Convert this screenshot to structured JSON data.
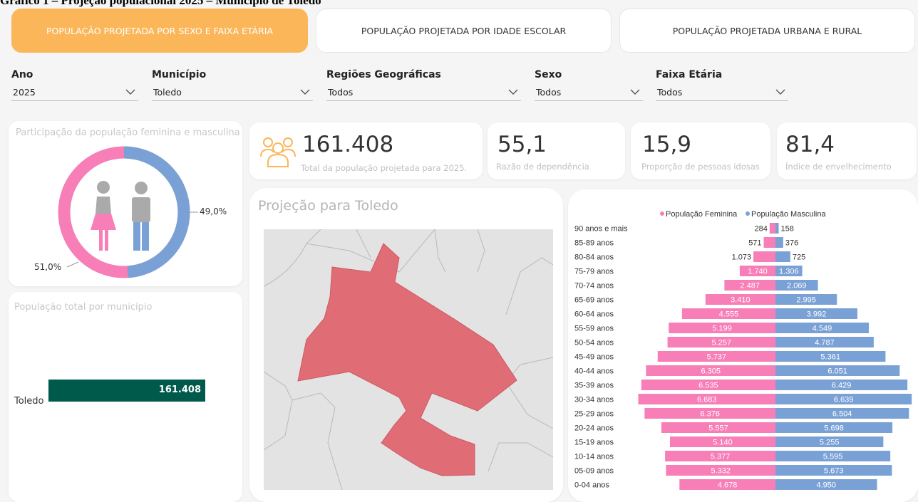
{
  "heading": "Gráfico 1 – Projeção populacional 2025 – Município de Toledo",
  "tabs": [
    {
      "label": "POPULAÇÃO PROJETADA POR SEXO E FAIXA ETÁRIA",
      "active": true
    },
    {
      "label": "POPULAÇÃO PROJETADA POR IDADE ESCOLAR",
      "active": false
    },
    {
      "label": "POPULAÇÃO PROJETADA URBANA E RURAL",
      "active": false
    }
  ],
  "filters": [
    {
      "label": "Ano",
      "value": "2025"
    },
    {
      "label": "Município",
      "value": "Toledo"
    },
    {
      "label": "Regiões Geográficas",
      "value": "Todos"
    },
    {
      "label": "Sexo",
      "value": "Todos"
    },
    {
      "label": "Faixa Etária",
      "value": "Todos"
    }
  ],
  "donut": {
    "title": "Participação da população feminina e masculina",
    "male_label": "49,0%",
    "female_label": "51,0%",
    "male_share": 0.49,
    "female_color": "#f77eb6",
    "male_color": "#7aa1d6"
  },
  "kpis": [
    {
      "value": "161.408",
      "label": "Total da população projetada para 2025."
    },
    {
      "value": "55,1",
      "label": "Razão de dependência"
    },
    {
      "value": "15,9",
      "label": "Proporção de pessoas idosas"
    },
    {
      "value": "81,4",
      "label": "Índice de envelhecimento"
    }
  ],
  "bar": {
    "title": "População total por município",
    "category": "Toledo",
    "value_label": "161.408",
    "color": "#005a4c"
  },
  "map": {
    "title": "Projeção para Toledo",
    "fill": "#e06c75"
  },
  "chart_data": {
    "type": "bar",
    "orientation": "horizontal",
    "stacking": "population pyramid",
    "legend_position": "top",
    "categories": [
      "90 anos e mais",
      "85-89 anos",
      "80-84 anos",
      "75-79 anos",
      "70-74 anos",
      "65-69 anos",
      "60-64 anos",
      "55-59 anos",
      "50-54 anos",
      "45-49 anos",
      "40-44 anos",
      "35-39 anos",
      "30-34 anos",
      "25-29 anos",
      "20-24 anos",
      "15-19 anos",
      "10-14 anos",
      "05-09 anos",
      "0-04 anos"
    ],
    "series": [
      {
        "name": "População Feminina",
        "color": "#f77eb6",
        "values": [
          284,
          571,
          1073,
          1740,
          2487,
          3410,
          4555,
          5199,
          5257,
          5737,
          6305,
          6535,
          6683,
          6376,
          5557,
          5140,
          5377,
          5332,
          4678
        ],
        "labels": [
          "284",
          "571",
          "1.073",
          "1.740",
          "2.487",
          "3.410",
          "4.555",
          "5.199",
          "5.257",
          "5.737",
          "6.305",
          "6.535",
          "6.683",
          "6.376",
          "5.557",
          "5.140",
          "5.377",
          "5.332",
          "4.678"
        ]
      },
      {
        "name": "População Masculina",
        "color": "#7aa1d6",
        "values": [
          158,
          376,
          725,
          1306,
          2069,
          2995,
          3992,
          4549,
          4787,
          5361,
          6051,
          6429,
          6639,
          6504,
          5698,
          5255,
          5595,
          5673,
          4950
        ],
        "labels": [
          "158",
          "376",
          "725",
          "1.306",
          "2.069",
          "2.995",
          "3.992",
          "4.549",
          "4.787",
          "5.361",
          "6.051",
          "6.429",
          "6.639",
          "6.504",
          "5.698",
          "5.255",
          "5.595",
          "5.673",
          "4.950"
        ]
      }
    ]
  }
}
